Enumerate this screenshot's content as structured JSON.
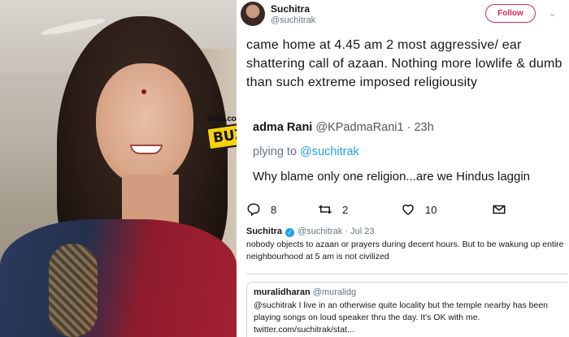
{
  "logo": {
    "site": "india.com",
    "word": "BUZZ"
  },
  "tweet": {
    "display_name": "Suchitra",
    "handle": "@suchitrak",
    "follow_label": "Follow",
    "text": "came home at 4.45 am 2 most aggressive/ ear shattering call of azaan. Nothing more lowlife & dumb than such extreme imposed religiousity"
  },
  "quoted": {
    "name": "adma Rani",
    "handle": "@KPadmaRani1 · 23h",
    "replying_prefix": "plying to ",
    "replying_mention": "@suchitrak",
    "text": "Why blame only one religion...are we Hindus laggin"
  },
  "actions": {
    "reply_count": "8",
    "retweet_count": "2",
    "like_count": "10"
  },
  "reply1": {
    "name": "Suchitra",
    "handle": "@suchitrak · Jul 23",
    "text": "nobody objects to azaan or prayers during decent hours. But to be wakung up entire neighbourhood at 5 am is not civilized"
  },
  "reply2": {
    "name": "muralidharan",
    "handle": "@muralidg",
    "text": "@suchitrak I live in an otherwise quite locality but the temple nearby has been playing songs on loud speaker thru the day. It's OK with me. twitter.com/suchitrak/stat..."
  },
  "colors": {
    "accent": "#e0245e",
    "link": "#1da1f2",
    "logo_bg": "#f5d20a"
  },
  "icons": [
    "reply-icon",
    "retweet-icon",
    "like-icon",
    "verified-icon",
    "chevron-down-icon"
  ]
}
